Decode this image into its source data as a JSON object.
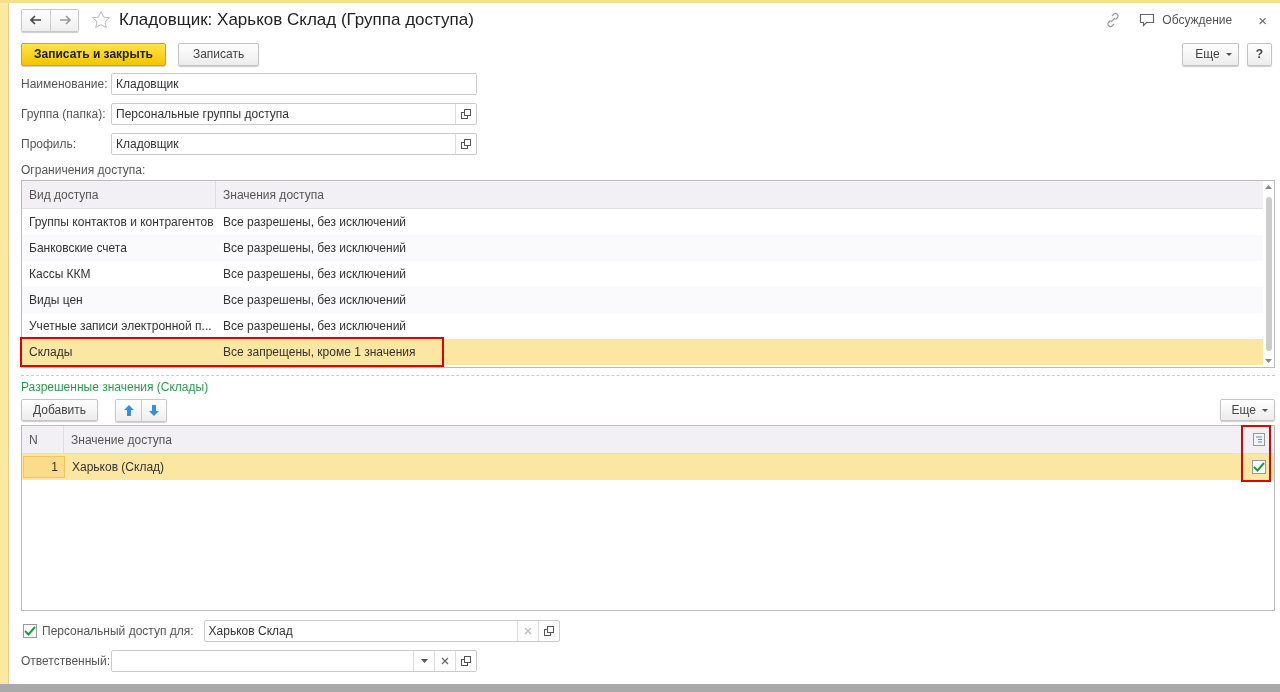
{
  "window": {
    "title": "Кладовщик: Харьков Склад (Группа доступа)",
    "favorite": false,
    "discussion": "Обсуждение",
    "close": "×"
  },
  "toolbar": {
    "primary": "Записать и закрыть",
    "save": "Записать",
    "more": "Еще",
    "help": "?"
  },
  "fields": [
    {
      "label": "Наименование:",
      "value": "Кладовщик",
      "open": false
    },
    {
      "label": "Группа (папка):",
      "value": "Персональные группы доступа",
      "open": true
    },
    {
      "label": "Профиль:",
      "value": "Кладовщик",
      "open": true
    }
  ],
  "restrictions": {
    "label": "Ограничения доступа:",
    "columns": [
      "Вид доступа",
      "Значения доступа"
    ],
    "rows": [
      {
        "kind": "Группы контактов и контрагентов",
        "value": "Все разрешены, без исключений",
        "selected": false,
        "highlighted": false
      },
      {
        "kind": "Банковские счета",
        "value": "Все разрешены, без исключений",
        "selected": false,
        "highlighted": false
      },
      {
        "kind": "Кассы ККМ",
        "value": "Все разрешены, без исключений",
        "selected": false,
        "highlighted": false
      },
      {
        "kind": "Виды цен",
        "value": "Все разрешены, без исключений",
        "selected": false,
        "highlighted": false
      },
      {
        "kind": "Учетные записи электронной п...",
        "value": "Все разрешены, без исключений",
        "selected": false,
        "highlighted": false
      },
      {
        "kind": "Склады",
        "value": "Все запрещены, кроме 1 значения",
        "selected": true,
        "highlighted": true
      }
    ]
  },
  "allowed": {
    "title": "Разрешенные значения (Склады)",
    "add": "Добавить",
    "more": "Еще",
    "columns": [
      "N",
      "Значение доступа"
    ],
    "check_column_highlighted": true,
    "rows": [
      {
        "n": "1",
        "value": "Харьков (Склад)",
        "selected": true,
        "checked": true
      }
    ]
  },
  "personal": {
    "label": "Персональный доступ для:",
    "checked": true,
    "value": "Харьков Склад"
  },
  "responsible": {
    "label": "Ответственный:"
  }
}
